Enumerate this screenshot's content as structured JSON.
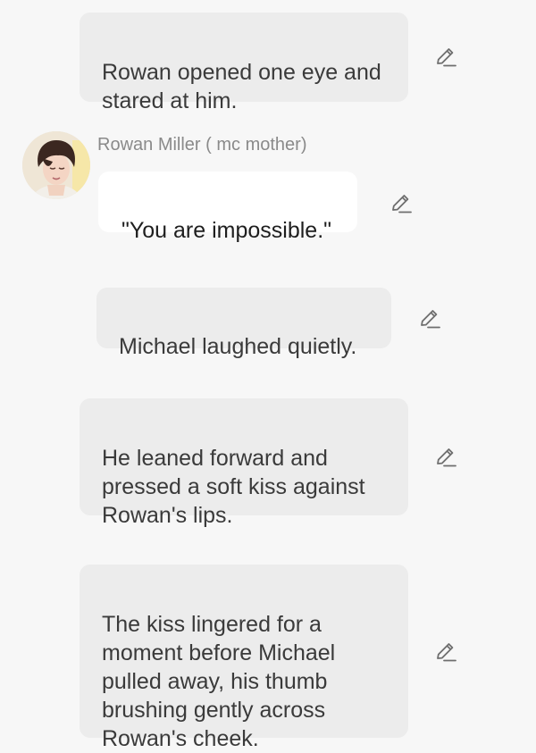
{
  "messages": [
    {
      "type": "narration",
      "text": "Rowan opened one eye and\nstared at him."
    },
    {
      "type": "speech",
      "speaker": "Rowan Miller ( mc mother)",
      "text": "\"You are impossible.\""
    },
    {
      "type": "narration",
      "text": "Michael laughed quietly."
    },
    {
      "type": "narration",
      "text": "He leaned forward and\npressed a soft kiss against\nRowan's lips."
    },
    {
      "type": "narration",
      "text": "The kiss lingered for a\nmoment before Michael\npulled away, his thumb\nbrushing gently across\nRowan's cheek."
    }
  ],
  "icons": {
    "edit": "pencil-edit-icon",
    "avatar": "character-avatar"
  },
  "colors": {
    "background": "#f7f7f7",
    "narration_bubble": "#ececec",
    "speech_bubble": "#ffffff",
    "speaker_name": "#8a8a8a",
    "icon": "#6e6e6e"
  }
}
